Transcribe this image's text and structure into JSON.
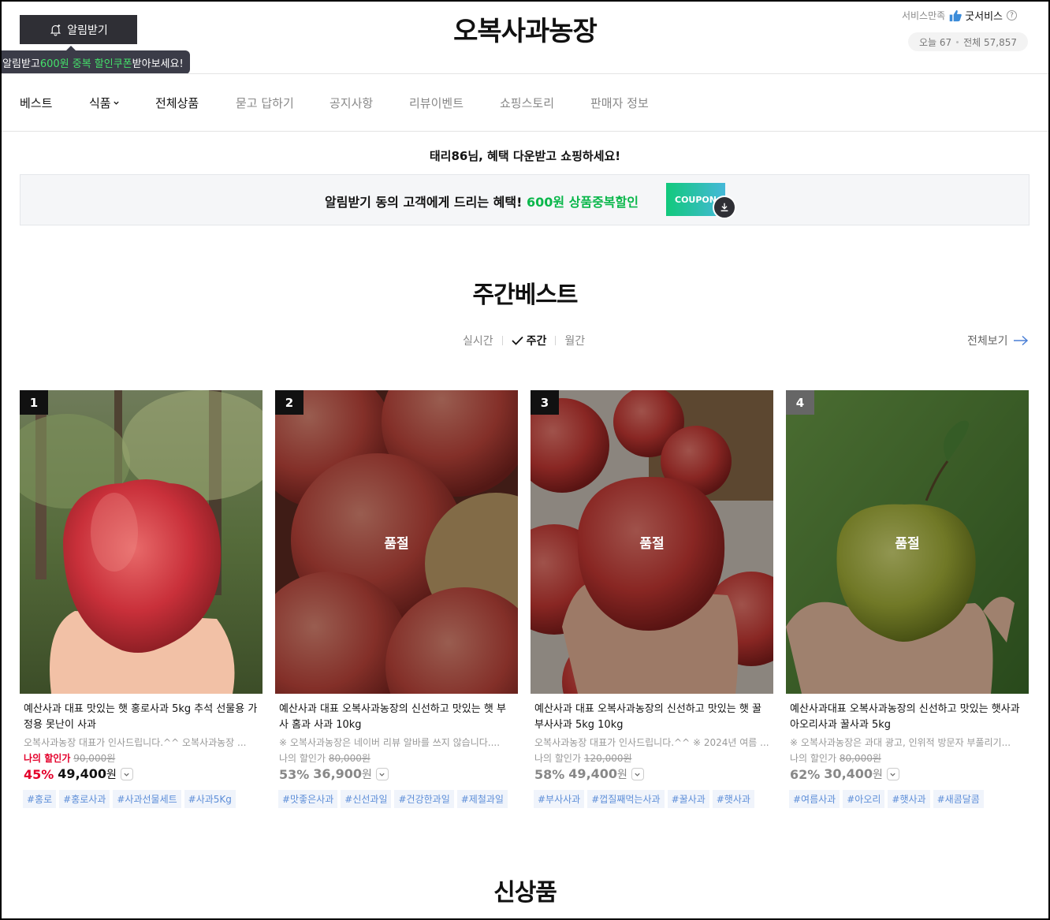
{
  "header": {
    "notify_label": "알림받기",
    "tooltip": {
      "pre": "알림받고 ",
      "amount": "600원 중복 할인쿠폰",
      "post": " 받아보세요!"
    },
    "store_name": "오복사과농장",
    "service_label": "서비스만족",
    "service_grade": "굿서비스",
    "help": "?",
    "visits": {
      "today": "오늘 67",
      "total": "전체 57,857"
    }
  },
  "nav": [
    {
      "label": "베스트"
    },
    {
      "label": "식품"
    },
    {
      "label": "전체상품"
    },
    {
      "label": "묻고 답하기"
    },
    {
      "label": "공지사항"
    },
    {
      "label": "리뷰이벤트"
    },
    {
      "label": "쇼핑스토리"
    },
    {
      "label": "판매자 정보"
    }
  ],
  "greeting": {
    "name": "태리86",
    "text": "님, 혜택 다운받고 쇼핑하세요!"
  },
  "benefit": {
    "text": "알림받기 동의 고객에게 드리는 혜택! ",
    "highlight": "600원 상품중복할인",
    "coupon": "COUPON"
  },
  "weekly": {
    "title": "주간베스트",
    "tabs": [
      "실시간",
      "주간",
      "월간"
    ],
    "view_all": "전체보기",
    "products": [
      {
        "rank": "1",
        "name": "예산사과 대표 맛있는 햇 홍로사과 5kg 추석 선물용 가정용 못난이 사과",
        "desc": "오복사과농장 대표가 인사드립니다.^^ 오복사과농장 ...",
        "my_label": "나의 할인가",
        "orig": "90,000원",
        "rate": "45%",
        "price": "49,400",
        "won": "원",
        "soldout": "",
        "tags": [
          "#홍로",
          "#홍로사과",
          "#사과선물세트",
          "#사과5Kg"
        ]
      },
      {
        "rank": "2",
        "name": "예산사과 대표 오복사과농장의 신선하고 맛있는 햇 부사 홈과 사과 10kg",
        "desc": "※ 오복사과농장은 네이버 리뷰 알바를 쓰지 않습니다....",
        "my_label": "나의 할인가",
        "orig": "80,000원",
        "rate": "53%",
        "price": "36,900",
        "won": "원",
        "soldout": "품절",
        "tags": [
          "#맛좋은사과",
          "#신선과일",
          "#건강한과일",
          "#제철과일"
        ]
      },
      {
        "rank": "3",
        "name": "예산사과 대표 오복사과농장의 신선하고 맛있는 햇 꿀 부사사과 5kg 10kg",
        "desc": "오복사과농장 대표가 인사드립니다.^^ ※ 2024년 여름 ...",
        "my_label": "나의 할인가",
        "orig": "120,000원",
        "rate": "58%",
        "price": "49,400",
        "won": "원",
        "soldout": "품절",
        "tags": [
          "#부사사과",
          "#껍질째먹는사과",
          "#꿀사과",
          "#햇사과"
        ]
      },
      {
        "rank": "4",
        "name": "예산사과대표 오복사과농장의 신선하고 맛있는 햇사과 아오리사과 꿀사과 5kg",
        "desc": "※ 오복사과농장은 과대 광고, 인위적 방문자 부풀리기...",
        "my_label": "나의 할인가",
        "orig": "80,000원",
        "rate": "62%",
        "price": "30,400",
        "won": "원",
        "soldout": "품절",
        "tags": [
          "#여름사과",
          "#아오리",
          "#햇사과",
          "#새콤달콤"
        ]
      }
    ]
  },
  "new_title": "신상품",
  "colors": {
    "accent_green": "#0ab74b",
    "sale_red": "#e4002b",
    "tag_blue": "#5d8ed8",
    "dark": "#2f2f35"
  }
}
